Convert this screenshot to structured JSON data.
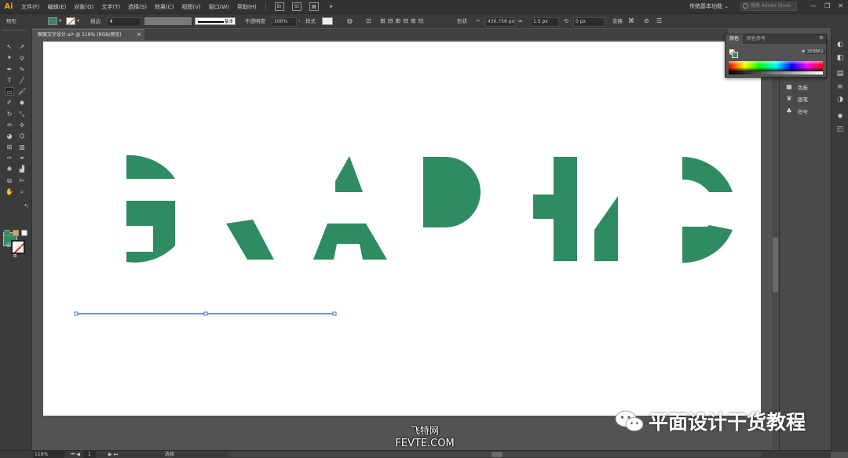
{
  "app": {
    "logo": "Ai"
  },
  "menu": [
    "文件(F)",
    "编辑(E)",
    "对象(O)",
    "文字(T)",
    "选择(S)",
    "效果(C)",
    "视图(V)",
    "窗口(W)",
    "帮助(H)"
  ],
  "menu_icons": {
    "bridge": "Br",
    "stock": "St"
  },
  "workspace": "传统基本功能",
  "search": {
    "placeholder": "搜索 Adobe Stock"
  },
  "window_controls": {
    "minimize": "—",
    "maximize": "❐",
    "close": "✕"
  },
  "controlbar": {
    "selection_type": "矩形",
    "fill_color": "#2e8b62",
    "stroke_label": "描边",
    "stroke_style": "基本",
    "opacity_label": "不透明度",
    "opacity_value": "100%",
    "style_label": "样式",
    "shape_label": "形状",
    "width_value": "430.756 px",
    "height_value": "1.5 px",
    "rotation_value": "0 px",
    "transform_label": "变换"
  },
  "document_tab": {
    "title": "图案文字设计.ai* @ 119% (RGB/预览)",
    "close": "×"
  },
  "artwork": {
    "word": "GRAPHIC",
    "fill_color": "#2e8b62",
    "selected_path_color": "#4a72c8"
  },
  "color_panel": {
    "tabs": [
      "颜色",
      "颜色参考"
    ],
    "hex_prefix": "#",
    "hex_value": "2E8B62",
    "menu_icon": "≡"
  },
  "side_panel": {
    "items": [
      {
        "label": "色板",
        "icon": "swatches-icon"
      },
      {
        "label": "画笔",
        "icon": "brush-icon"
      },
      {
        "label": "符号",
        "icon": "symbol-icon"
      }
    ]
  },
  "statusbar": {
    "zoom": "119%",
    "page": "1",
    "status": "选择"
  },
  "watermarks": {
    "wechat_account": "平面设计干货教程",
    "site_cn": "飞特网",
    "site_en": "FEVTE.COM"
  }
}
